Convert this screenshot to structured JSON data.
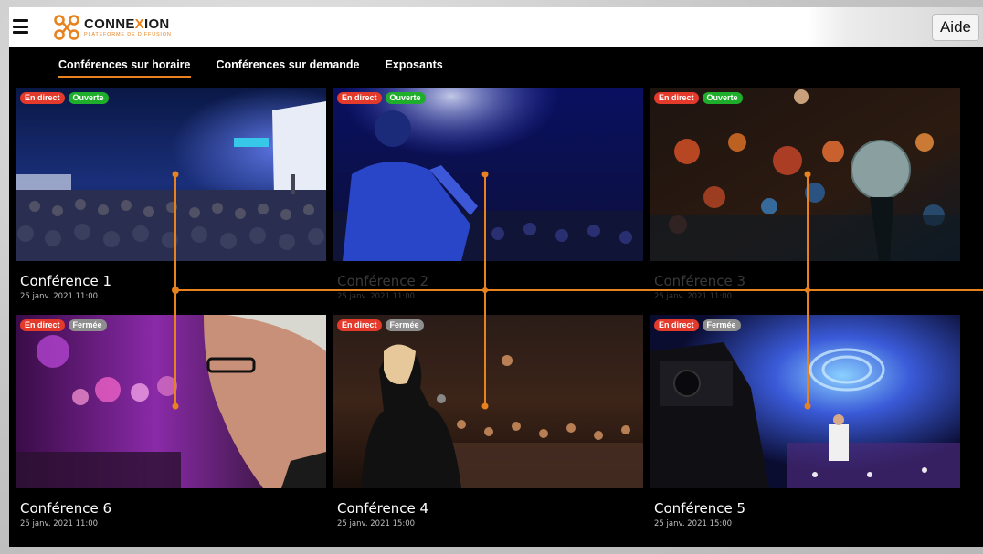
{
  "header": {
    "menu_icon": "hamburger-icon",
    "logo": {
      "name_a": "CONNE",
      "name_x": "X",
      "name_b": "ION",
      "subtitle": "PLATEFORME DE DIFFUSION"
    },
    "help_label": "Aide"
  },
  "tabs": [
    {
      "label": "Conférences sur horaire",
      "active": true
    },
    {
      "label": "Conférences sur demande",
      "active": false
    },
    {
      "label": "Exposants",
      "active": false
    }
  ],
  "cards": [
    {
      "title": "Conférence 1",
      "date": "25 janv. 2021 11:00",
      "badges": [
        "En direct",
        "Ouverte"
      ]
    },
    {
      "title": "Conférence 2",
      "date": "25 janv. 2021 11:00",
      "badges": [
        "En direct",
        "Ouverte"
      ]
    },
    {
      "title": "Conférence 3",
      "date": "25 janv. 2021 11:00",
      "badges": [
        "En direct",
        "Ouverte"
      ]
    },
    {
      "title": "Conférence 6",
      "date": "25 janv. 2021 11:00",
      "badges": [
        "En direct",
        "Fermée"
      ]
    },
    {
      "title": "Conférence 4",
      "date": "25 janv. 2021 15:00",
      "badges": [
        "En direct",
        "Fermée"
      ]
    },
    {
      "title": "Conférence 5",
      "date": "25 janv. 2021 15:00",
      "badges": [
        "En direct",
        "Fermée"
      ]
    }
  ],
  "colors": {
    "accent": "#e7821f",
    "live": "#e43a2b",
    "open": "#1fae2c",
    "closed": "#8e8e8e"
  }
}
